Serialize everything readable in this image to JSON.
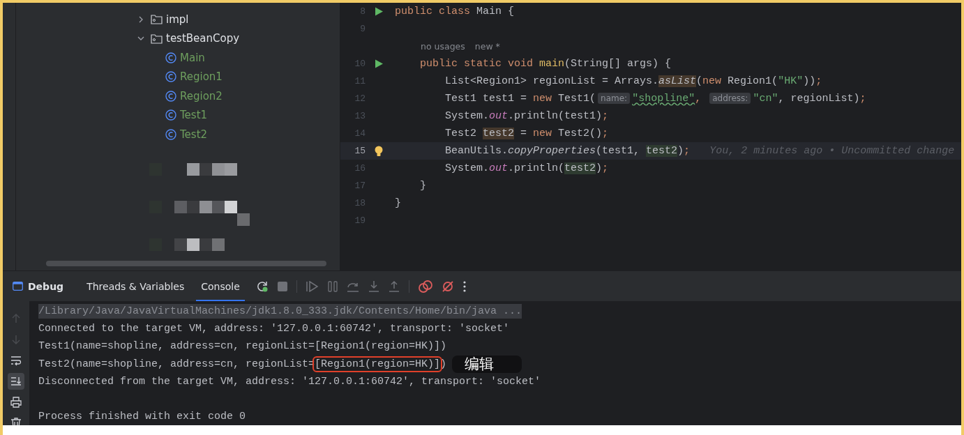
{
  "project_tree": {
    "items": [
      {
        "label": "impl",
        "kind": "folder",
        "expanded": false
      },
      {
        "label": "testBeanCopy",
        "kind": "folder",
        "expanded": true,
        "children": [
          {
            "label": "Main",
            "kind": "class"
          },
          {
            "label": "Region1",
            "kind": "class"
          },
          {
            "label": "Region2",
            "kind": "class"
          },
          {
            "label": "Test1",
            "kind": "class"
          },
          {
            "label": "Test2",
            "kind": "class"
          }
        ]
      }
    ]
  },
  "editor": {
    "lines": [
      {
        "kind": "code",
        "number": "8",
        "run": true,
        "tokens": [
          {
            "text": "public ",
            "kind": "kw"
          },
          {
            "text": "class ",
            "kind": "kw"
          },
          {
            "text": "Main {",
            "kind": "plain"
          }
        ]
      },
      {
        "kind": "code",
        "number": "9"
      },
      {
        "kind": "usages",
        "texts": [
          "no usages",
          "new *"
        ]
      },
      {
        "kind": "code",
        "number": "10",
        "run": true,
        "tokens": [
          {
            "text": "    public ",
            "kind": "kw"
          },
          {
            "text": "static ",
            "kind": "kw"
          },
          {
            "text": "void ",
            "kind": "kw"
          },
          {
            "text": "main",
            "kind": "fn"
          },
          {
            "text": "(String[] args) {",
            "kind": "plain"
          }
        ]
      },
      {
        "kind": "code",
        "number": "11",
        "tokens": [
          {
            "text": "        List<Region1> regionList = Arrays.",
            "kind": "plain"
          },
          {
            "text": "asList",
            "kind": "static",
            "write_highlight": true
          },
          {
            "text": "(",
            "kind": "plain"
          },
          {
            "text": "new ",
            "kind": "kw"
          },
          {
            "text": "Region1(",
            "kind": "plain"
          },
          {
            "text": "\"HK\"",
            "kind": "str"
          },
          {
            "text": "))",
            "kind": "plain"
          },
          {
            "text": ";",
            "kind": "punct"
          }
        ]
      },
      {
        "kind": "code",
        "number": "12",
        "tokens": [
          {
            "text": "        Test1 test1 = ",
            "kind": "plain"
          },
          {
            "text": "new ",
            "kind": "kw"
          },
          {
            "text": "Test1(",
            "kind": "plain"
          },
          {
            "text": "name:",
            "kind": "inlay"
          },
          {
            "text": "\"shopline\"",
            "kind": "str",
            "typo": true
          },
          {
            "text": ", ",
            "kind": "punct"
          },
          {
            "text": "address:",
            "kind": "inlay"
          },
          {
            "text": "\"cn\"",
            "kind": "str"
          },
          {
            "text": ", regionList)",
            "kind": "plain"
          },
          {
            "text": ";",
            "kind": "punct"
          }
        ]
      },
      {
        "kind": "code",
        "number": "13",
        "tokens": [
          {
            "text": "        System.",
            "kind": "plain"
          },
          {
            "text": "out",
            "kind": "field"
          },
          {
            "text": ".println(test1)",
            "kind": "plain"
          },
          {
            "text": ";",
            "kind": "punct"
          }
        ]
      },
      {
        "kind": "code",
        "number": "14",
        "tokens": [
          {
            "text": "        Test2 ",
            "kind": "plain"
          },
          {
            "text": "test2",
            "kind": "plain",
            "write_highlight": true
          },
          {
            "text": " = ",
            "kind": "plain"
          },
          {
            "text": "new ",
            "kind": "kw"
          },
          {
            "text": "Test2()",
            "kind": "plain"
          },
          {
            "text": ";",
            "kind": "punct"
          }
        ]
      },
      {
        "kind": "code",
        "number": "15",
        "current": true,
        "bulb": true,
        "tokens": [
          {
            "text": "        BeanUtils.",
            "kind": "plain"
          },
          {
            "text": "copyProperties",
            "kind": "static"
          },
          {
            "text": "(test1, ",
            "kind": "plain"
          },
          {
            "text": "test2",
            "kind": "plain",
            "read_highlight": true
          },
          {
            "text": ")",
            "kind": "plain"
          },
          {
            "text": ";",
            "kind": "punct"
          }
        ],
        "blame": "You, 2 minutes ago • Uncommitted change"
      },
      {
        "kind": "code",
        "number": "16",
        "tokens": [
          {
            "text": "        System.",
            "kind": "plain"
          },
          {
            "text": "out",
            "kind": "field"
          },
          {
            "text": ".println(",
            "kind": "plain"
          },
          {
            "text": "test2",
            "kind": "plain",
            "read_highlight": true
          },
          {
            "text": ")",
            "kind": "plain"
          },
          {
            "text": ";",
            "kind": "punct"
          }
        ]
      },
      {
        "kind": "code",
        "number": "17",
        "tokens": [
          {
            "text": "    }",
            "kind": "plain"
          }
        ]
      },
      {
        "kind": "code",
        "number": "18",
        "tokens": [
          {
            "text": "}",
            "kind": "plain"
          }
        ]
      },
      {
        "kind": "code",
        "number": "19"
      }
    ]
  },
  "debug_toolbar": {
    "title": "Debug",
    "tabs": [
      {
        "label": "Threads & Variables",
        "selected": false
      },
      {
        "label": "Console",
        "selected": true
      }
    ]
  },
  "console": {
    "side_tools": [
      {
        "kind": "up",
        "disabled": true
      },
      {
        "kind": "down",
        "disabled": true
      },
      {
        "kind": "wrap",
        "selected": false
      },
      {
        "kind": "scroll-end",
        "selected": true
      },
      {
        "kind": "print"
      },
      {
        "kind": "trash"
      }
    ],
    "lines": [
      {
        "kind": "command",
        "segments": [
          {
            "text": "/Library/Java/JavaVirtualMachines/jdk1.8.0_333.jdk/Contents/Home/bin/java ..."
          }
        ]
      },
      {
        "kind": "output",
        "segments": [
          {
            "text": "Connected to the target VM, address: '127.0.0.1:60742', transport: 'socket'"
          }
        ]
      },
      {
        "kind": "output",
        "segments": [
          {
            "text": "Test1(name=shopline, address=cn, regionList=[Region1(region=HK)])"
          }
        ]
      },
      {
        "kind": "output",
        "segments": [
          {
            "text": "Test2(name=shopline, address=cn, regionList="
          },
          {
            "text": "[Region1(region=HK)]",
            "boxed": true
          },
          {
            "text": ")"
          }
        ],
        "tooltip": "编辑"
      },
      {
        "kind": "output",
        "segments": [
          {
            "text": "Disconnected from the target VM, address: '127.0.0.1:60742', transport: 'socket'"
          }
        ]
      },
      {
        "kind": "blank"
      },
      {
        "kind": "output",
        "segments": [
          {
            "text": "Process finished with exit code 0"
          }
        ]
      }
    ]
  }
}
